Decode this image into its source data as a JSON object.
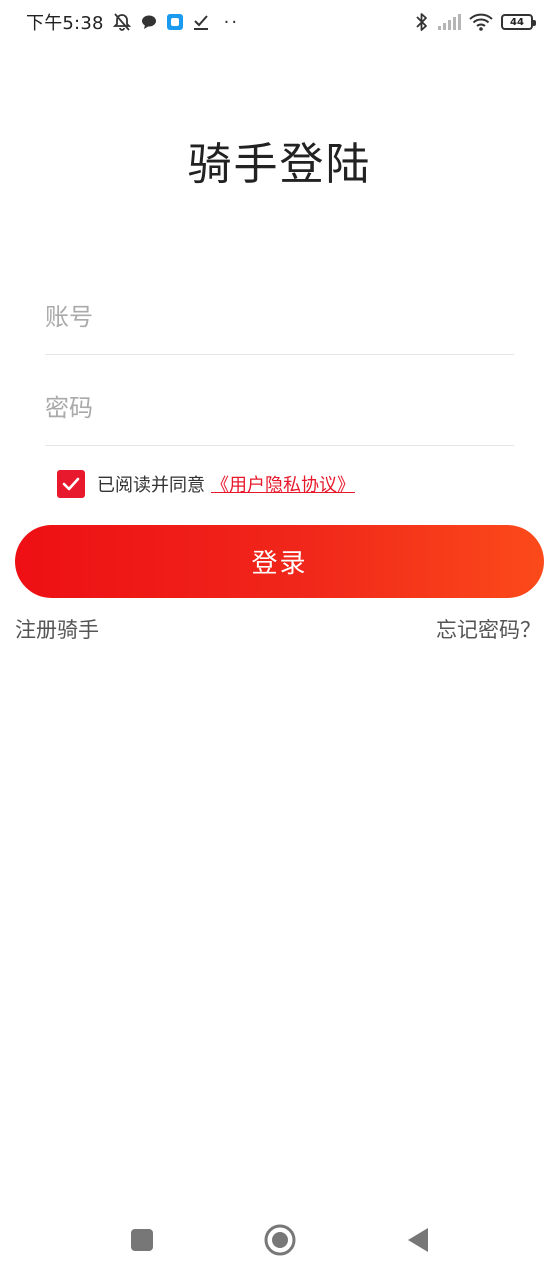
{
  "status_bar": {
    "time": "下午5:38",
    "battery_level": "44",
    "icons": [
      "mute-bell-icon",
      "chat-bubble-icon",
      "app-square-icon",
      "check-download-icon",
      "more-dots-icon",
      "bluetooth-icon",
      "signal-icon",
      "wifi-icon",
      "battery-icon"
    ],
    "more_dots": "··"
  },
  "page": {
    "title": "骑手登陆"
  },
  "form": {
    "account_placeholder": "账号",
    "password_placeholder": "密码",
    "agreement_text": "已阅读并同意",
    "agreement_link": "《用户隐私协议》",
    "agreement_checked": true,
    "login_label": "登录"
  },
  "links": {
    "register": "注册骑手",
    "forgot_password": "忘记密码？"
  },
  "colors": {
    "accent": "#e8192c",
    "button_gradient_start": "#ee0f14",
    "button_gradient_end": "#fc4a1a"
  },
  "nav_bar": {
    "icons": [
      "recent-apps-icon",
      "home-icon",
      "back-icon"
    ]
  }
}
